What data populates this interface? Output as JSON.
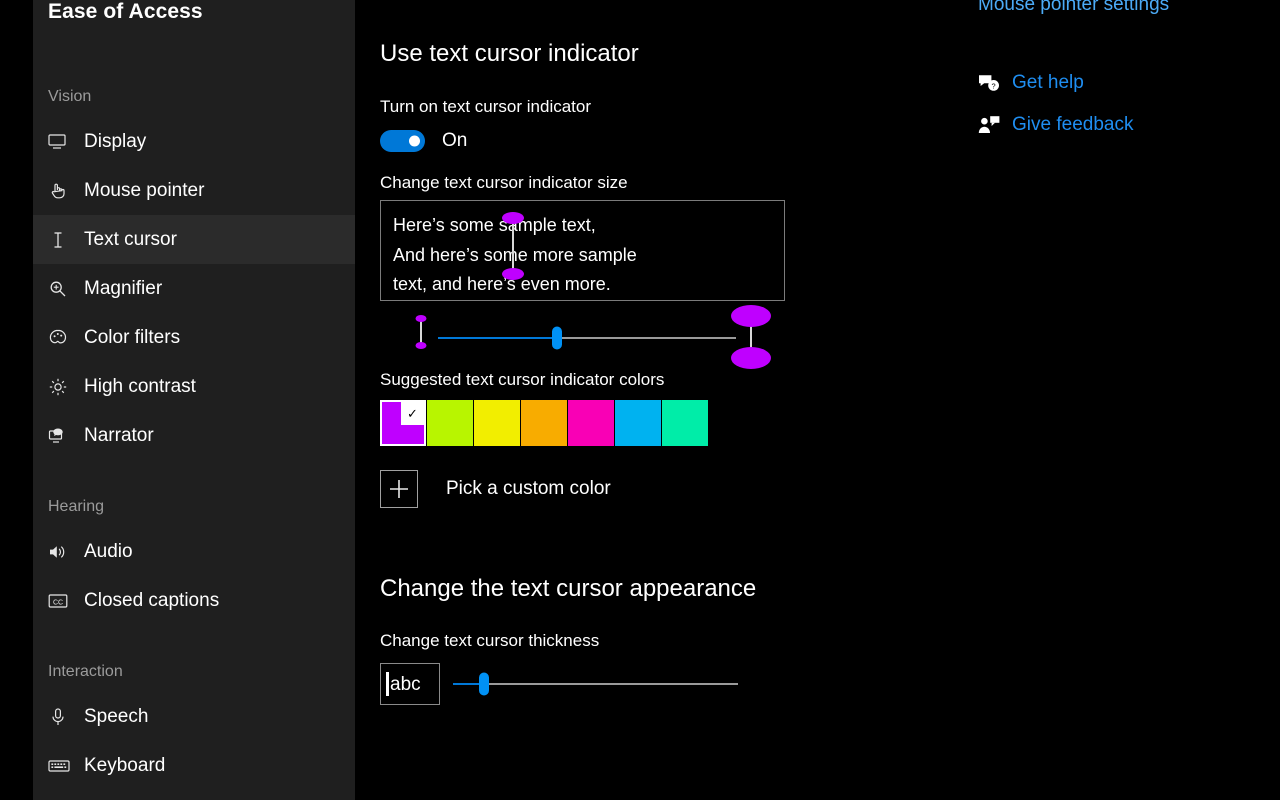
{
  "sidebar": {
    "title": "Ease of Access",
    "groups": [
      {
        "label": "Vision",
        "items": [
          {
            "label": "Display",
            "icon": "monitor-icon",
            "selected": false
          },
          {
            "label": "Mouse pointer",
            "icon": "hand-pointer-icon",
            "selected": false
          },
          {
            "label": "Text cursor",
            "icon": "i-beam-icon",
            "selected": true
          },
          {
            "label": "Magnifier",
            "icon": "magnifier-icon",
            "selected": false
          },
          {
            "label": "Color filters",
            "icon": "palette-icon",
            "selected": false
          },
          {
            "label": "High contrast",
            "icon": "sun-icon",
            "selected": false
          },
          {
            "label": "Narrator",
            "icon": "narrator-icon",
            "selected": false
          }
        ]
      },
      {
        "label": "Hearing",
        "items": [
          {
            "label": "Audio",
            "icon": "speaker-icon",
            "selected": false
          },
          {
            "label": "Closed captions",
            "icon": "closed-caption-icon",
            "selected": false
          }
        ]
      },
      {
        "label": "Interaction",
        "items": [
          {
            "label": "Speech",
            "icon": "microphone-icon",
            "selected": false
          },
          {
            "label": "Keyboard",
            "icon": "keyboard-icon",
            "selected": false
          }
        ]
      }
    ]
  },
  "main": {
    "heading": "Use text cursor indicator",
    "toggle": {
      "label": "Turn on text cursor indicator",
      "state": "On",
      "on": true
    },
    "size": {
      "label": "Change text cursor indicator size",
      "preview_lines": [
        "Here’s some sample text,",
        "And here’s some more sample",
        "text, and here’s even more."
      ],
      "slider_percent": 40
    },
    "colors": {
      "label": "Suggested text cursor indicator colors",
      "swatches": [
        {
          "name": "magenta",
          "hex": "#bf00ff",
          "selected": true
        },
        {
          "name": "yellow-green",
          "hex": "#b8f500",
          "selected": false
        },
        {
          "name": "yellow",
          "hex": "#f2ee00",
          "selected": false
        },
        {
          "name": "orange",
          "hex": "#f8ac00",
          "selected": false
        },
        {
          "name": "pink",
          "hex": "#f900b5",
          "selected": false
        },
        {
          "name": "cyan",
          "hex": "#00b2f0",
          "selected": false
        },
        {
          "name": "spring-green",
          "hex": "#00eda8",
          "selected": false
        }
      ],
      "selected_check": "✓",
      "custom_color_label": "Pick a custom color"
    },
    "appearance": {
      "heading": "Change the text cursor appearance",
      "thickness_label": "Change text cursor thickness",
      "thickness_preview_text": "abc",
      "thickness_percent": 11
    }
  },
  "right_panel": {
    "related_link": "Mouse pointer settings",
    "help_links": [
      {
        "label": "Get help",
        "icon": "help-bubble-icon"
      },
      {
        "label": "Give feedback",
        "icon": "feedback-person-icon"
      }
    ]
  },
  "theme": {
    "accent": "#0078d7",
    "link": "#1f8ef1",
    "sidebar_bg": "#1f1f1f",
    "content_bg": "#000000"
  }
}
